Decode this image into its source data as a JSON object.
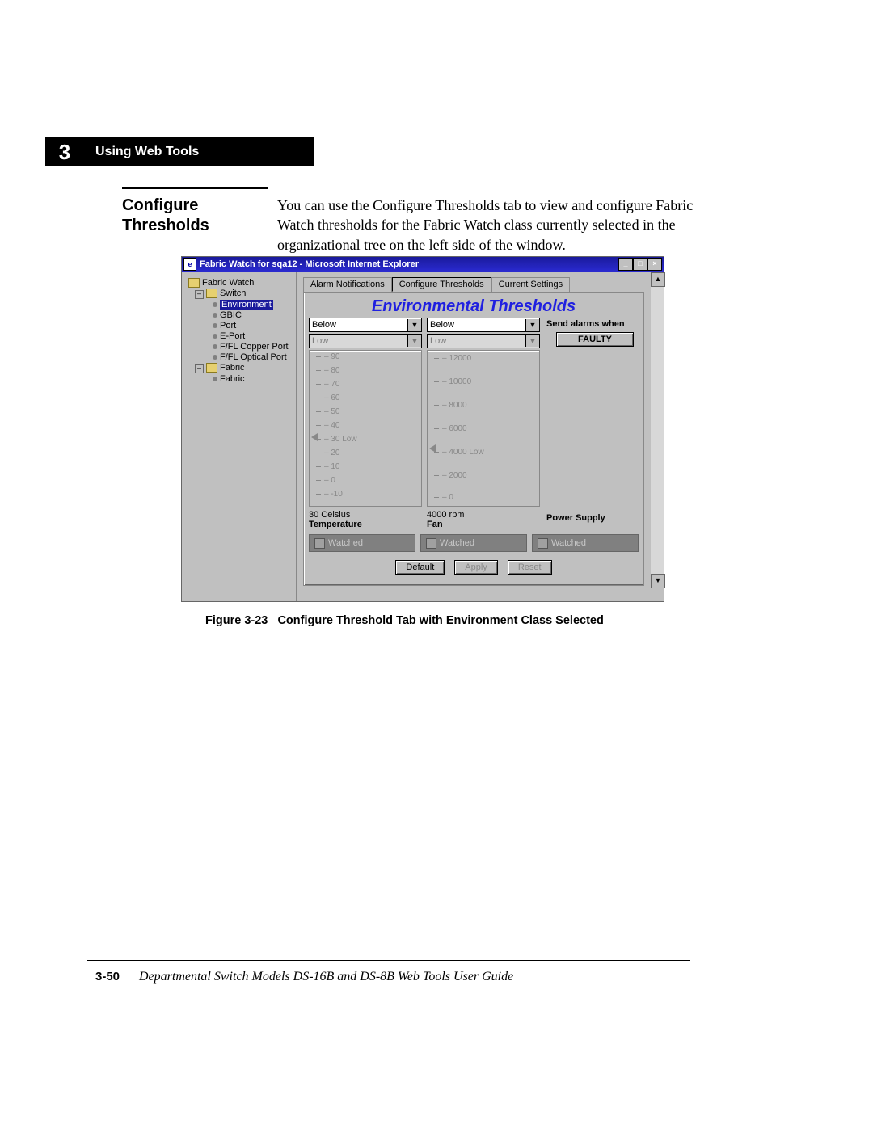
{
  "chapter": {
    "number": "3",
    "title": "Using Web Tools"
  },
  "section": {
    "heading": "Configure Thresholds"
  },
  "body": "You can use the Configure Thresholds tab to view and configure Fabric Watch thresholds for the Fabric Watch class currently selected in the organizational tree on the left side of the window.",
  "figure": {
    "label": "Figure 3-23",
    "caption": "Configure Threshold Tab with Environment Class Selected"
  },
  "footer": {
    "page": "3-50",
    "title": "Departmental Switch Models DS-16B and DS-8B Web Tools User Guide"
  },
  "win": {
    "title": "Fabric Watch for sqa12 - Microsoft Internet Explorer",
    "min": "_",
    "max": "□",
    "close": "×",
    "tree": {
      "root": "Fabric Watch",
      "switch": "Switch",
      "env": "Environment",
      "gbic": "GBIC",
      "port": "Port",
      "eport": "E-Port",
      "copper": "F/FL Copper Port",
      "optical": "F/FL Optical Port",
      "fabric_folder": "Fabric",
      "fabric": "Fabric"
    },
    "tabs": {
      "alarm": "Alarm Notifications",
      "config": "Configure Thresholds",
      "current": "Current Settings"
    },
    "panel_title": "Environmental Thresholds",
    "col1": {
      "sel1": "Below",
      "sel2": "Low",
      "ticks": [
        "90",
        "80",
        "70",
        "60",
        "50",
        "40",
        "30 Low",
        "20",
        "10",
        "0",
        "-10"
      ],
      "unit": "30 Celsius",
      "name": "Temperature",
      "pointer_at": 6
    },
    "col2": {
      "sel1": "Below",
      "sel2": "Low",
      "ticks": [
        "12000",
        "10000",
        "8000",
        "6000",
        "4000 Low",
        "2000",
        "0"
      ],
      "unit": "4000 rpm",
      "name": "Fan",
      "pointer_at": 4
    },
    "col3": {
      "alarms": "Send alarms when",
      "faulty": "FAULTY",
      "name": "Power Supply"
    },
    "watched": "Watched",
    "buttons": {
      "default": "Default",
      "apply": "Apply",
      "reset": "Reset"
    }
  }
}
